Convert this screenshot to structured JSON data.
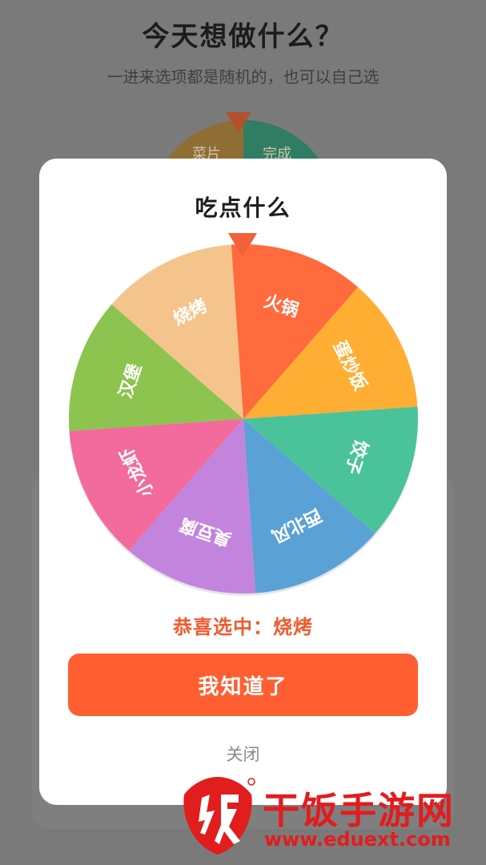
{
  "background": {
    "title": "今天想做什么？",
    "subtitle": "一进来选项都是随机的，也可以自己选",
    "wheel_labels": [
      "菜片",
      "完成"
    ]
  },
  "dialog": {
    "title": "吃点什么",
    "result_text": "恭喜选中：烧烤",
    "confirm_label": "我知道了",
    "close_label": "关闭"
  },
  "wheel": {
    "segments": [
      {
        "label": "火锅",
        "color": "#ff6b3d"
      },
      {
        "label": "蛋炒饭",
        "color": "#ffae34"
      },
      {
        "label": "饺子",
        "color": "#4ac39a"
      },
      {
        "label": "西北风",
        "color": "#5aa2d6"
      },
      {
        "label": "臭豆腐",
        "color": "#c384de"
      },
      {
        "label": "小龙虾",
        "color": "#f26b9c"
      },
      {
        "label": "汉堡",
        "color": "#8dc34f"
      },
      {
        "label": "烧烤",
        "color": "#f5c48c"
      }
    ],
    "pointer_color": "#f2613a"
  },
  "watermark": {
    "name": "干饭手游网",
    "url": "www.eduext.com",
    "color": "#e11d1d"
  }
}
